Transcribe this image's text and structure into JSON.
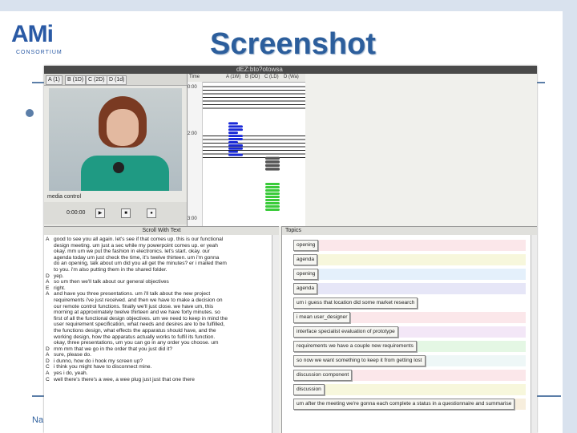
{
  "slide": {
    "title": "Screenshot",
    "logo_text": "AMi",
    "logo_sub": "CONSORTIUM",
    "footer": "Na"
  },
  "app": {
    "window_title": "dEZ:bto?otowsa",
    "video_tabs": [
      "A (1)",
      "B (1D)",
      "C (2D)",
      "D (1d)"
    ],
    "media_label": "media control",
    "time": "0:00:00",
    "timeline_columns": [
      "Time",
      "A (1W)",
      "B (DD)",
      "C (LD)",
      "D (Wa)"
    ],
    "timeline_ticks": [
      "0:00",
      "2:00",
      "3:00"
    ]
  },
  "transcript": {
    "title": "Scroll With Text",
    "lines": [
      {
        "spk": "A",
        "text": "good to see you all again. let's see if that comes up. this is our functional"
      },
      {
        "spk": "",
        "text": "design meeting. um just a sec while my powerpoint comes up. er yeah"
      },
      {
        "spk": "",
        "text": "okay. mm um we put the fashion in electronics. let's start. okay. our"
      },
      {
        "spk": "",
        "text": "agenda today um just check the time, it's twelve thirteen. um i'm gonna"
      },
      {
        "spk": "",
        "text": "do an opening, talk about um did you all get the minutes? er i mailed them"
      },
      {
        "spk": "",
        "text": "to you. i'm also putting them in the shared folder."
      },
      {
        "spk": "D",
        "text": "yep."
      },
      {
        "spk": "A",
        "text": "so um then we'll talk about our general objectives"
      },
      {
        "spk": "E",
        "text": "right."
      },
      {
        "spk": "A",
        "text": "and have you three presentations. um i'll talk about the new project"
      },
      {
        "spk": "",
        "text": "requirements i've just received. and then we have to make a decision on"
      },
      {
        "spk": "",
        "text": "our remote control functions. finally we'll just close. we have um, this"
      },
      {
        "spk": "",
        "text": "morning at approximately twelve thirteen and we have forty minutes. so"
      },
      {
        "spk": "",
        "text": "first of all the functional design objectives. um we need to keep in mind the"
      },
      {
        "spk": "",
        "text": "user requirement specification, what needs and desires are to be fulfilled,"
      },
      {
        "spk": "",
        "text": "the functions design, what effects the apparatus should have, and the"
      },
      {
        "spk": "",
        "text": "working design, how the apparatus actually works to fulfil its function."
      },
      {
        "spk": "",
        "text": "okay, three presentations, um you can go in any order you choose. um"
      },
      {
        "spk": "D",
        "text": "mm mm that we go in the order that you just did it?"
      },
      {
        "spk": "A",
        "text": "sure, please do."
      },
      {
        "spk": "D",
        "text": "i dunno, how do i hook my screen up?"
      },
      {
        "spk": "C",
        "text": "i think you might have to disconnect mine."
      },
      {
        "spk": "A",
        "text": "yes i do, yeah."
      },
      {
        "spk": "C",
        "text": "well there's there's a wee, a wee plug just just that one there"
      }
    ]
  },
  "topics": {
    "title": "Topics",
    "items": [
      {
        "label": "opening",
        "color": "#fbe7ea"
      },
      {
        "label": "agenda",
        "color": "#f7f7dc"
      },
      {
        "label": "opening",
        "color": "#e4f0fb"
      },
      {
        "label": "agenda",
        "color": "#e6e6f7"
      },
      {
        "label": "um i guess that location did some market research",
        "color": "#ffffff"
      },
      {
        "label": "i mean user_designer",
        "color": "#fbe7ea"
      },
      {
        "label": "interface specialist evaluation of prototype",
        "color": "#f3e7f7"
      },
      {
        "label": "requirements we have a couple new requirements",
        "color": "#e4f7e4"
      },
      {
        "label": "so now we want something to keep it from getting lost",
        "color": "#eef7f7"
      },
      {
        "label": "discussion component",
        "color": "#fbe7ea"
      },
      {
        "label": "discussion",
        "color": "#f7f7dc"
      },
      {
        "label": "um after the meeting we're gonna each complete a status in a questionnaire and summarise",
        "color": "#f7eedd"
      }
    ]
  },
  "colors": {
    "accent": "#2c5e9c",
    "timeline_blue": "#1a2ad8",
    "timeline_green": "#3acb3a",
    "timeline_gray": "#555555"
  },
  "timeline_segments": [
    {
      "col": 0,
      "from": 0.0,
      "to": 0.34,
      "kind": "line"
    },
    {
      "col": 1,
      "from": 0.28,
      "to": 0.52,
      "kind": "blue"
    },
    {
      "col": 2,
      "from": 0.52,
      "to": 0.62,
      "kind": "gray"
    },
    {
      "col": 2,
      "from": 0.7,
      "to": 0.9,
      "kind": "green"
    }
  ]
}
